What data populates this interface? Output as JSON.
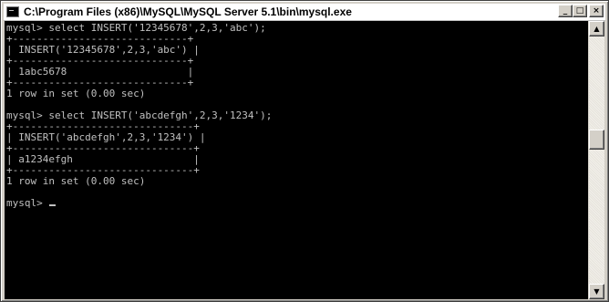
{
  "window": {
    "title": "C:\\Program Files (x86)\\MySQL\\MySQL Server 5.1\\bin\\mysql.exe",
    "icon": "console-icon",
    "buttons": {
      "minimize": "_",
      "maximize": "□",
      "close": "×"
    }
  },
  "console": {
    "lines": [
      "mysql> select INSERT('12345678',2,3,'abc');",
      "+-----------------------------+",
      "| INSERT('12345678',2,3,'abc') |",
      "+-----------------------------+",
      "| 1abc5678                    |",
      "+-----------------------------+",
      "1 row in set (0.00 sec)",
      "",
      "mysql> select INSERT('abcdefgh',2,3,'1234');",
      "+------------------------------+",
      "| INSERT('abcdefgh',2,3,'1234') |",
      "+------------------------------+",
      "| a1234efgh                    |",
      "+------------------------------+",
      "1 row in set (0.00 sec)",
      "",
      "mysql> "
    ]
  },
  "scrollbar": {
    "up_arrow": "▲",
    "down_arrow": "▼"
  },
  "colors": {
    "console_bg": "#000000",
    "console_text": "#c0c0c0",
    "chrome": "#d4d0c8"
  }
}
